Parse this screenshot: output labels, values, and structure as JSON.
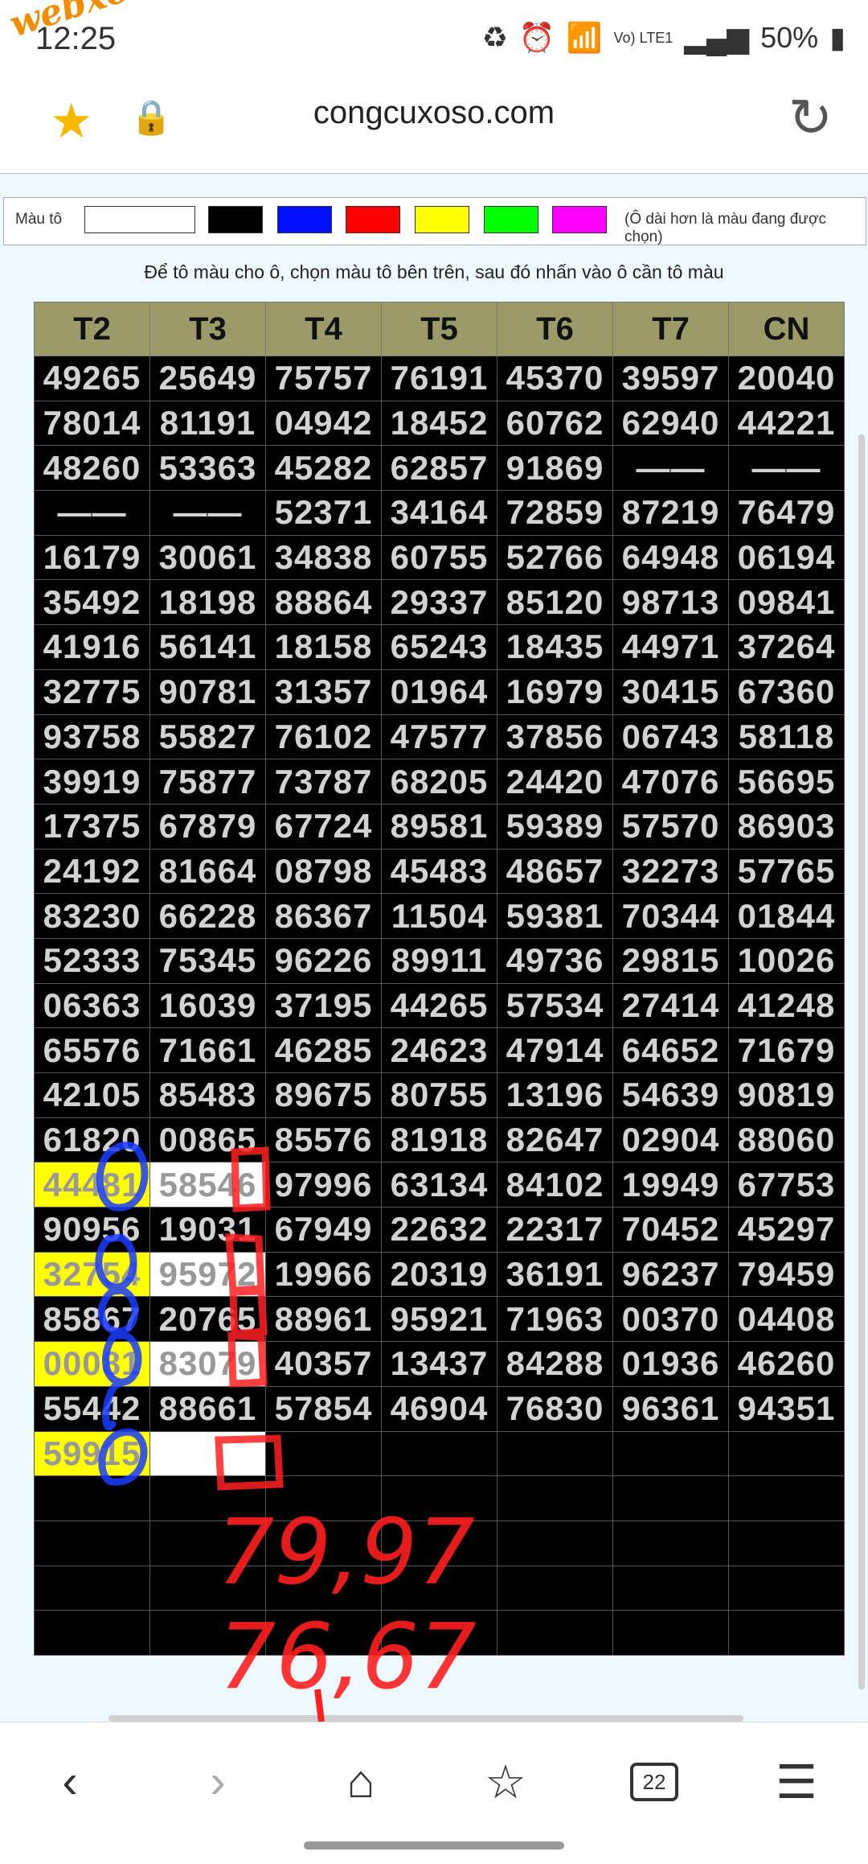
{
  "status": {
    "time": "12:25",
    "network": "Vo) LTE1",
    "battery": "50%"
  },
  "watermark": "webxoso.net",
  "browser": {
    "url": "congcuxoso.com",
    "tab_count": "22"
  },
  "palette": {
    "label": "Màu tô",
    "colors": [
      "#ffffff",
      "#000000",
      "#0010ff",
      "#ff0000",
      "#ffff00",
      "#00ff00",
      "#ff00ff"
    ],
    "hint": "(Ô dài hơn là màu đang được chọn)"
  },
  "instruction": "Để tô màu cho ô, chọn màu tô bên trên, sau đó nhấn vào ô cần tô màu",
  "table": {
    "headers": [
      "T2",
      "T3",
      "T4",
      "T5",
      "T6",
      "T7",
      "CN"
    ],
    "rows": [
      [
        "49265",
        "25649",
        "75757",
        "76191",
        "45370",
        "39597",
        "20040"
      ],
      [
        "78014",
        "81191",
        "04942",
        "18452",
        "60762",
        "62940",
        "44221"
      ],
      [
        "48260",
        "53363",
        "45282",
        "62857",
        "91869",
        "——",
        "——"
      ],
      [
        "——",
        "——",
        "52371",
        "34164",
        "72859",
        "87219",
        "76479"
      ],
      [
        "16179",
        "30061",
        "34838",
        "60755",
        "52766",
        "64948",
        "06194"
      ],
      [
        "35492",
        "18198",
        "88864",
        "29337",
        "85120",
        "98713",
        "09841"
      ],
      [
        "41916",
        "56141",
        "18158",
        "65243",
        "18435",
        "44971",
        "37264"
      ],
      [
        "32775",
        "90781",
        "31357",
        "01964",
        "16979",
        "30415",
        "67360"
      ],
      [
        "93758",
        "55827",
        "76102",
        "47577",
        "37856",
        "06743",
        "58118"
      ],
      [
        "39919",
        "75877",
        "73787",
        "68205",
        "24420",
        "47076",
        "56695"
      ],
      [
        "17375",
        "67879",
        "67724",
        "89581",
        "59389",
        "57570",
        "86903"
      ],
      [
        "24192",
        "81664",
        "08798",
        "45483",
        "48657",
        "32273",
        "57765"
      ],
      [
        "83230",
        "66228",
        "86367",
        "11504",
        "59381",
        "70344",
        "01844"
      ],
      [
        "52333",
        "75345",
        "96226",
        "89911",
        "49736",
        "29815",
        "10026"
      ],
      [
        "06363",
        "16039",
        "37195",
        "44265",
        "57534",
        "27414",
        "41248"
      ],
      [
        "65576",
        "71661",
        "46285",
        "24623",
        "47914",
        "64652",
        "71679"
      ],
      [
        "42105",
        "85483",
        "89675",
        "80755",
        "13196",
        "54639",
        "90819"
      ],
      [
        "61820",
        "00865",
        "85576",
        "81918",
        "82647",
        "02904",
        "88060"
      ],
      [
        "44481",
        "58546",
        "97996",
        "63134",
        "84102",
        "19949",
        "67753"
      ],
      [
        "90956",
        "19031",
        "67949",
        "22632",
        "22317",
        "70452",
        "45297"
      ],
      [
        "32754",
        "95972",
        "19966",
        "20319",
        "36191",
        "96237",
        "79459"
      ],
      [
        "85867",
        "20765",
        "88961",
        "95921",
        "71963",
        "00370",
        "04408"
      ],
      [
        "00081",
        "83079",
        "40357",
        "13437",
        "84288",
        "01936",
        "46260"
      ],
      [
        "55442",
        "88661",
        "57854",
        "46904",
        "76830",
        "96361",
        "94351"
      ],
      [
        "59915",
        "",
        "",
        "",
        "",
        "",
        ""
      ],
      [
        "",
        "",
        "",
        "",
        "",
        "",
        ""
      ],
      [
        "",
        "",
        "",
        "",
        "",
        "",
        ""
      ],
      [
        "",
        "",
        "",
        "",
        "",
        "",
        ""
      ],
      [
        "",
        "",
        "",
        "",
        "",
        "",
        ""
      ]
    ],
    "highlights": [
      {
        "row": 18,
        "col": 0,
        "color": "#ffff00"
      },
      {
        "row": 18,
        "col": 1,
        "color": "#ffffff"
      },
      {
        "row": 20,
        "col": 0,
        "color": "#ffff00"
      },
      {
        "row": 20,
        "col": 1,
        "color": "#ffffff"
      },
      {
        "row": 22,
        "col": 0,
        "color": "#ffff00"
      },
      {
        "row": 22,
        "col": 1,
        "color": "#ffffff"
      },
      {
        "row": 24,
        "col": 0,
        "color": "#ffff00"
      },
      {
        "row": 24,
        "col": 1,
        "color": "#ffffff"
      }
    ]
  },
  "handwriting": {
    "line1": "79,97",
    "line2": "76,67"
  }
}
